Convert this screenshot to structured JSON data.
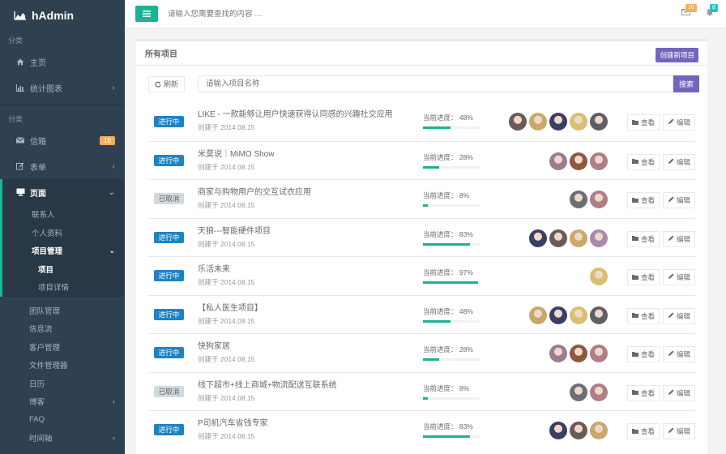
{
  "app": {
    "logo": "hAdmin"
  },
  "sidebar": {
    "group1": "分类",
    "group2": "分类",
    "items_top": [
      {
        "label": "主页",
        "icon": "home-icon"
      },
      {
        "label": "统计图表",
        "icon": "bar-chart-icon",
        "arrow": "‹"
      }
    ],
    "items_mid": [
      {
        "label": "信箱",
        "icon": "envelope-icon",
        "badge": "16"
      },
      {
        "label": "表单",
        "icon": "edit-icon",
        "arrow": "‹"
      }
    ],
    "pages": {
      "label": "页面",
      "icon": "desktop-icon",
      "arrow": "⌄"
    },
    "page_subs": [
      {
        "label": "联系人"
      },
      {
        "label": "个人资料"
      },
      {
        "label": "项目管理",
        "arrow": "⌄"
      }
    ],
    "project_subs": [
      {
        "label": "项目",
        "current": true
      },
      {
        "label": "项目详情"
      }
    ],
    "more": [
      {
        "label": "团队管理"
      },
      {
        "label": "信息流"
      },
      {
        "label": "客户管理"
      },
      {
        "label": "文件管理器"
      },
      {
        "label": "日历"
      },
      {
        "label": "博客",
        "arrow": "‹"
      },
      {
        "label": "FAQ"
      },
      {
        "label": "时间轴",
        "arrow": "‹"
      }
    ]
  },
  "topbar": {
    "search_placeholder": "请输入您需要查找的内容 …",
    "mail_count": "16",
    "bell_count": "8",
    "colors": {
      "accent": "#1ab394",
      "mail_badge": "#f8ac59",
      "bell_badge": "#23c6c8"
    }
  },
  "main": {
    "title": "所有项目",
    "new_button": "创建新项目",
    "refresh_label": "刷新",
    "search_placeholder": "请输入项目名称",
    "search_button": "搜索",
    "view_label": "查看",
    "edit_label": "编辑",
    "progress_prefix": "当前进度：",
    "projects": [
      {
        "status": "进行中",
        "status_type": "on",
        "title": "LIKE - 一款能够让用户快速获得认同感的兴趣社交应用",
        "date": "创建于 2014.08.15",
        "progress": 48,
        "avatar_colors": [
          "#6b5a5a",
          "#c9a86a",
          "#3b3f66",
          "#d8c070",
          "#5e6066"
        ]
      },
      {
        "status": "进行中",
        "status_type": "on",
        "title": "米莫说｜MiMO Show",
        "date": "创建于 2014.08.15",
        "progress": 28,
        "avatar_colors": [
          "#9c7c8e",
          "#8a5a40",
          "#b07e88"
        ]
      },
      {
        "status": "已取消",
        "status_type": "off",
        "title": "商家与购物用户的交互试衣应用",
        "date": "创建于 2014.08.15",
        "progress": 8,
        "avatar_colors": [
          "#6d6f75",
          "#b07e88"
        ]
      },
      {
        "status": "进行中",
        "status_type": "on",
        "title": "天狼---智能硬件项目",
        "date": "创建于 2014.08.15",
        "progress": 83,
        "avatar_colors": [
          "#3b3f66",
          "#6b5a5a",
          "#c9a86a",
          "#a889b0"
        ]
      },
      {
        "status": "进行中",
        "status_type": "on",
        "title": "乐活未来",
        "date": "创建于 2014.08.15",
        "progress": 97,
        "avatar_colors": [
          "#d8c070"
        ]
      },
      {
        "status": "进行中",
        "status_type": "on",
        "title": "【私人医生项目】",
        "date": "创建于 2014.08.15",
        "progress": 48,
        "avatar_colors": [
          "#c9a86a",
          "#3b3f66",
          "#d8c070",
          "#5e6066"
        ]
      },
      {
        "status": "进行中",
        "status_type": "on",
        "title": "快狗家居",
        "date": "创建于 2014.08.15",
        "progress": 28,
        "avatar_colors": [
          "#9c7c8e",
          "#8a5a40",
          "#b07e88"
        ]
      },
      {
        "status": "已取消",
        "status_type": "off",
        "title": "线下超市+线上商城+物流配送互联系统",
        "date": "创建于 2014.08.15",
        "progress": 8,
        "avatar_colors": [
          "#6d6f75",
          "#b07e88"
        ]
      },
      {
        "status": "进行中",
        "status_type": "on",
        "title": "P司机汽车省钱专家",
        "date": "创建于 2014.08.15",
        "progress": 83,
        "avatar_colors": [
          "#3b3f66",
          "#6b5a5a",
          "#c9a86a"
        ]
      }
    ]
  }
}
